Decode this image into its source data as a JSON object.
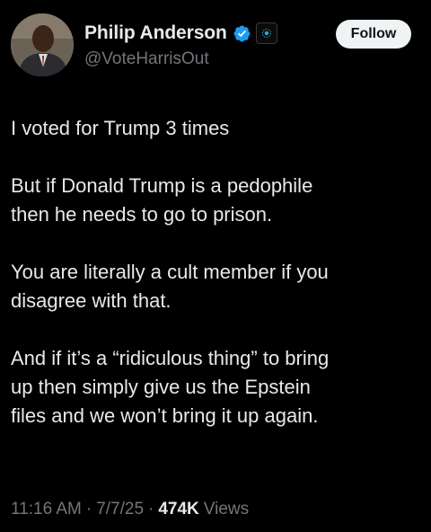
{
  "author": {
    "display_name": "Philip Anderson",
    "handle": "@VoteHarrisOut",
    "verified_icon": "verified-badge-icon",
    "affiliate_icon": "affiliate-badge-icon"
  },
  "actions": {
    "follow_label": "Follow"
  },
  "tweet": {
    "paragraphs": [
      "I voted for Trump 3 times",
      "But if Donald Trump is a pedophile\nthen he needs to go to prison.",
      "You are literally a cult member if you\ndisagree with that.",
      "And if it’s a “ridiculous thing” to bring\nup then simply give us the Epstein\nfiles and we won’t bring it up again."
    ]
  },
  "meta": {
    "time": "11:16 AM",
    "date": "7/7/25",
    "separator": "·",
    "views_count": "474K",
    "views_label": "Views"
  },
  "colors": {
    "background": "#000000",
    "text_primary": "#e7e9ea",
    "text_secondary": "#71767b",
    "verified_blue": "#1d9bf0",
    "follow_button_bg": "#eff3f4"
  }
}
